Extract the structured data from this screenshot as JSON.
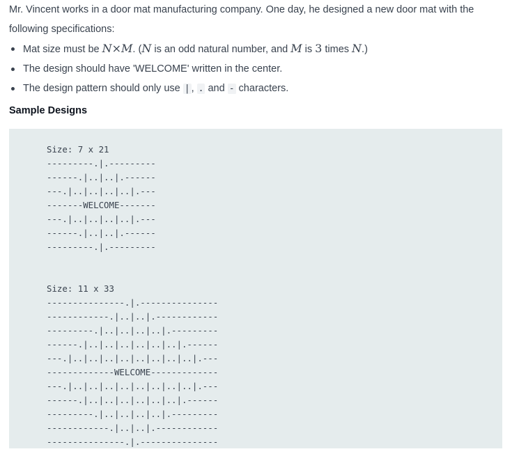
{
  "intro": {
    "text_before": "Mr. Vincent works in a door mat manufacturing company. One day, he designed a new door mat with the following specifications:"
  },
  "specs": [
    {
      "id": "size",
      "t1": "Mat size must be ",
      "m1": "N",
      "op": "×",
      "m2": "M",
      "t2": ". (",
      "m3": "N",
      "t3": " is an odd natural number, and ",
      "m4": "M",
      "t4": " is ",
      "m5": "3",
      "t5": " times ",
      "m6": "N",
      "t6": ".)"
    },
    {
      "id": "welcome",
      "text": "The design should have 'WELCOME' written in the center."
    },
    {
      "id": "chars",
      "t1": "The design pattern should only use ",
      "c1": "|",
      "t2": ", ",
      "c2": ".",
      "t3": " and ",
      "c3": "-",
      "t4": " characters."
    }
  ],
  "section_title": "Sample Designs",
  "samples": [
    {
      "size_label": "Size: 7 x 21",
      "lines": [
        "---------.|.---------",
        "------.|..|..|.------",
        "---.|..|..|..|..|.---",
        "-------WELCOME-------",
        "---.|..|..|..|..|.---",
        "------.|..|..|.------",
        "---------.|.---------"
      ]
    },
    {
      "size_label": "Size: 11 x 33",
      "lines": [
        "---------------.|.---------------",
        "------------.|..|..|.------------",
        "---------.|..|..|..|..|.---------",
        "------.|..|..|..|..|..|..|.------",
        "---.|..|..|..|..|..|..|..|..|.---",
        "-------------WELCOME-------------",
        "---.|..|..|..|..|..|..|..|..|.---",
        "------.|..|..|..|..|..|..|.------",
        "---------.|..|..|..|..|.---------",
        "------------.|..|..|.------------",
        "---------------.|.---------------"
      ]
    }
  ],
  "colors": {
    "text": "#39424e",
    "heading": "#0e141e",
    "code_bg": "#e5eced"
  }
}
